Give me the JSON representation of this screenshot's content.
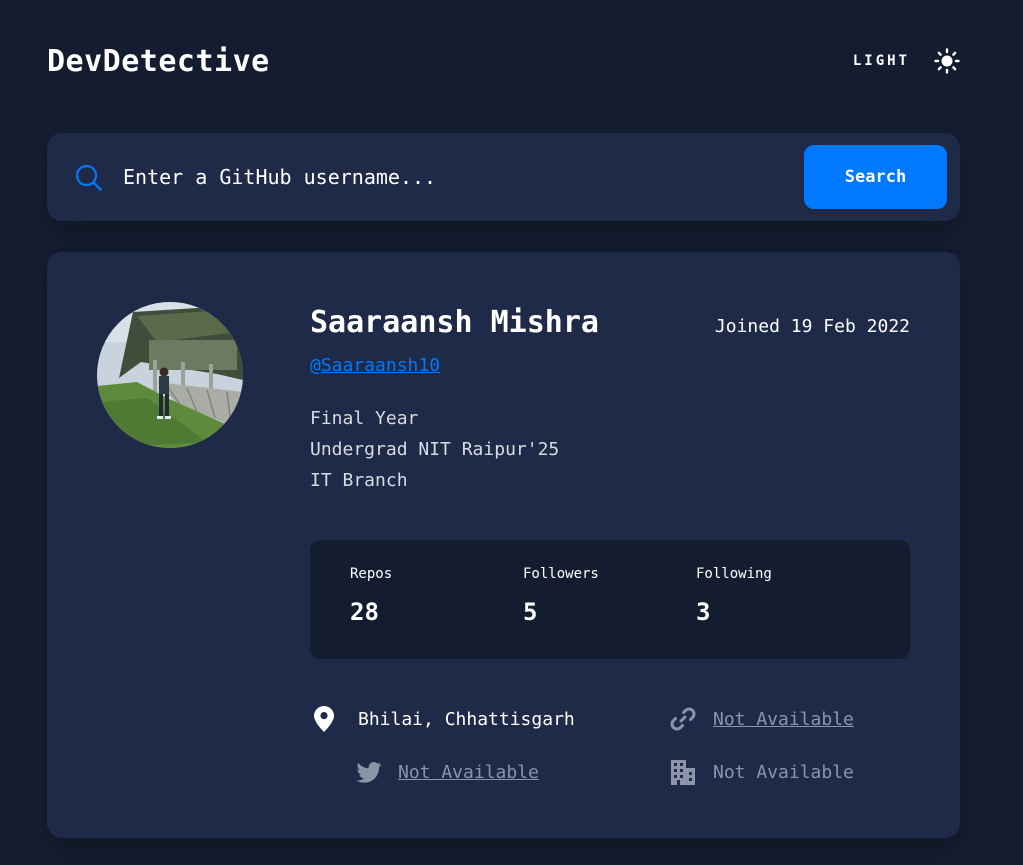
{
  "header": {
    "logo": "DevDetective",
    "mode_label": "LIGHT",
    "mode_icon": "sun-icon"
  },
  "search": {
    "icon": "search-icon",
    "placeholder": "Enter a GitHub username...",
    "button_label": "Search"
  },
  "profile": {
    "name": "Saaraansh Mishra",
    "joined": "Joined 19 Feb 2022",
    "username": "@Saaraansh10",
    "bio_lines": [
      "Final Year",
      "Undergrad NIT Raipur'25",
      "IT Branch"
    ],
    "stats": [
      {
        "label": "Repos",
        "value": "28"
      },
      {
        "label": "Followers",
        "value": "5"
      },
      {
        "label": "Following",
        "value": "3"
      }
    ],
    "links": {
      "location": {
        "icon": "location-pin-icon",
        "text": "Bhilai, Chhattisgarh"
      },
      "website": {
        "icon": "link-icon",
        "text": "Not Available"
      },
      "twitter": {
        "icon": "twitter-icon",
        "text": "Not Available"
      },
      "company": {
        "icon": "building-icon",
        "text": "Not Available"
      }
    }
  },
  "colors": {
    "background": "#141d2f",
    "card": "#1e2a47",
    "accent": "#0079ff",
    "muted": "#8c95a8"
  }
}
